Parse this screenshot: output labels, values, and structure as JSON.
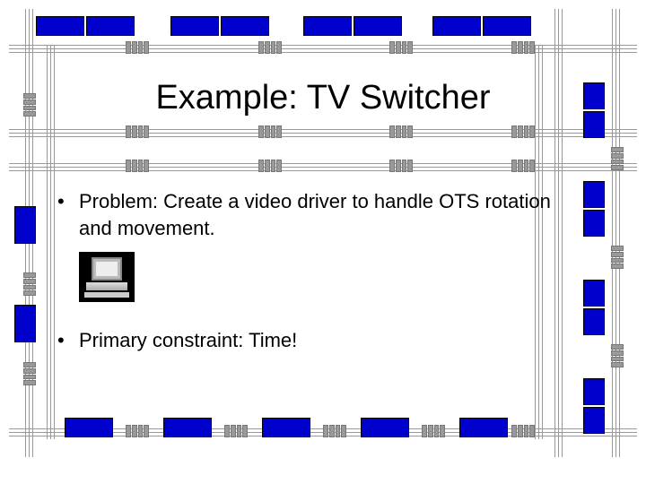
{
  "title": "Example: TV Switcher",
  "bullets": {
    "b1": "Problem: Create a video driver to handle OTS rotation and movement.",
    "b2": "Primary constraint: Time!"
  },
  "icon": {
    "name": "computer-icon"
  },
  "colors": {
    "accent": "#0000cc",
    "line": "#999999"
  }
}
